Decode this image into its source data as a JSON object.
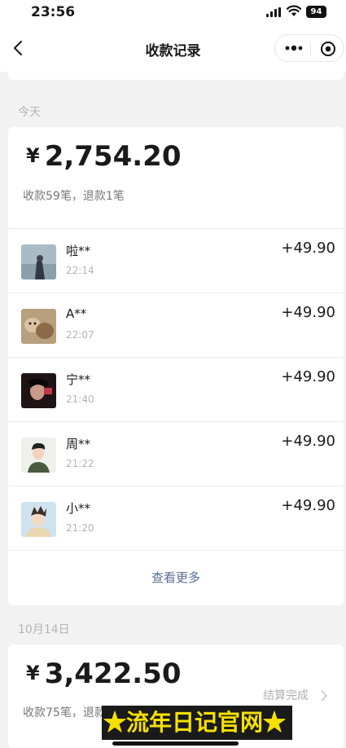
{
  "status_bar": {
    "time": "23:56",
    "battery": "94"
  },
  "nav": {
    "title": "收款记录",
    "back_icon": "chevron-left-icon",
    "more_icon": "more-dots-icon",
    "close_icon": "target-close-icon"
  },
  "sections": [
    {
      "label": "今天",
      "currency": "¥",
      "total": "2,754.20",
      "summary": "收款59笔，退款1笔",
      "transactions": [
        {
          "name": "啦**",
          "time": "22:14",
          "amount": "+49.90",
          "avatar": "avatar-landscape-photo"
        },
        {
          "name": "A**",
          "time": "22:07",
          "amount": "+49.90",
          "avatar": "avatar-pets-photo"
        },
        {
          "name": "宁**",
          "time": "21:40",
          "amount": "+49.90",
          "avatar": "avatar-dark-portrait"
        },
        {
          "name": "周**",
          "time": "21:22",
          "amount": "+49.90",
          "avatar": "avatar-cartoon-man"
        },
        {
          "name": "小**",
          "time": "21:20",
          "amount": "+49.90",
          "avatar": "avatar-cartoon-boy"
        }
      ],
      "view_more": "查看更多"
    },
    {
      "label": "10月14日",
      "currency": "¥",
      "total": "3,422.50",
      "summary": "收款75笔，退款0笔",
      "settle_status": "结算完成"
    }
  ],
  "watermark": "★流年日记官网★"
}
